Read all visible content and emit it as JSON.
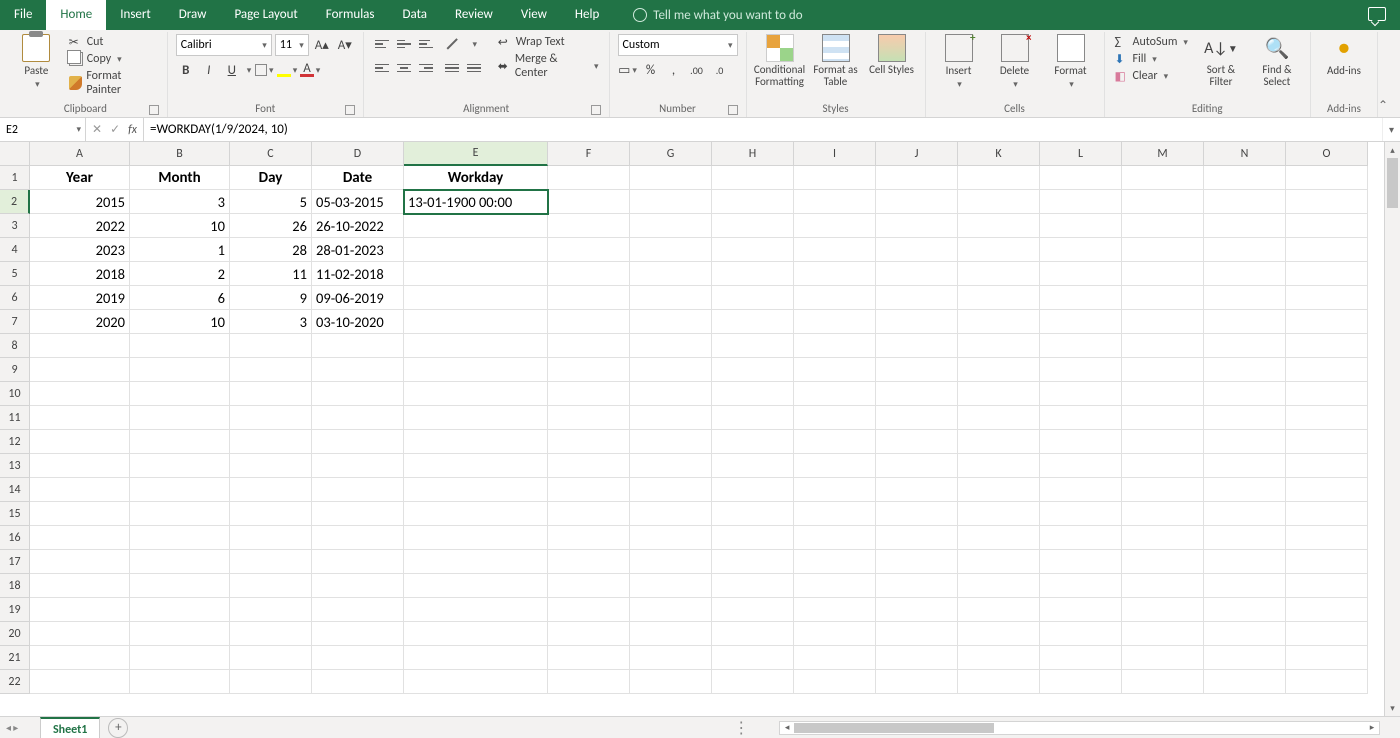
{
  "menu": {
    "tabs": [
      "File",
      "Home",
      "Insert",
      "Draw",
      "Page Layout",
      "Formulas",
      "Data",
      "Review",
      "View",
      "Help"
    ],
    "active_index": 1,
    "tellme": "Tell me what you want to do"
  },
  "ribbon": {
    "clipboard": {
      "paste": "Paste",
      "cut": "Cut",
      "copy": "Copy",
      "format_painter": "Format Painter",
      "label": "Clipboard"
    },
    "font": {
      "name": "Calibri",
      "size": "11",
      "bold": "B",
      "italic": "I",
      "underline": "U",
      "label": "Font"
    },
    "alignment": {
      "wrap": "Wrap Text",
      "merge": "Merge & Center",
      "label": "Alignment"
    },
    "number": {
      "format": "Custom",
      "label": "Number"
    },
    "styles": {
      "cond": "Conditional Formatting",
      "table": "Format as Table",
      "cell": "Cell Styles",
      "label": "Styles"
    },
    "cells": {
      "insert": "Insert",
      "delete": "Delete",
      "format": "Format",
      "label": "Cells"
    },
    "editing": {
      "autosum": "AutoSum",
      "fill": "Fill",
      "clear": "Clear",
      "sort": "Sort & Filter",
      "find": "Find & Select",
      "label": "Editing"
    },
    "addins": {
      "addins": "Add-ins",
      "label": "Add-ins"
    }
  },
  "namebox": "E2",
  "formula": "=WORKDAY(1/9/2024, 10)",
  "columns": [
    "A",
    "B",
    "C",
    "D",
    "E",
    "F",
    "G",
    "H",
    "I",
    "J",
    "K",
    "L",
    "M",
    "N",
    "O"
  ],
  "selected_col_index": 4,
  "selected_row": 2,
  "rows": 22,
  "headers": [
    "Year",
    "Month",
    "Day",
    "Date",
    "Workday"
  ],
  "data": [
    {
      "year": "2015",
      "month": "3",
      "day": "5",
      "date": "05-03-2015",
      "workday": "13-01-1900 00:00"
    },
    {
      "year": "2022",
      "month": "10",
      "day": "26",
      "date": "26-10-2022",
      "workday": ""
    },
    {
      "year": "2023",
      "month": "1",
      "day": "28",
      "date": "28-01-2023",
      "workday": ""
    },
    {
      "year": "2018",
      "month": "2",
      "day": "11",
      "date": "11-02-2018",
      "workday": ""
    },
    {
      "year": "2019",
      "month": "6",
      "day": "9",
      "date": "09-06-2019",
      "workday": ""
    },
    {
      "year": "2020",
      "month": "10",
      "day": "3",
      "date": "03-10-2020",
      "workday": ""
    }
  ],
  "sheet": {
    "name": "Sheet1"
  }
}
